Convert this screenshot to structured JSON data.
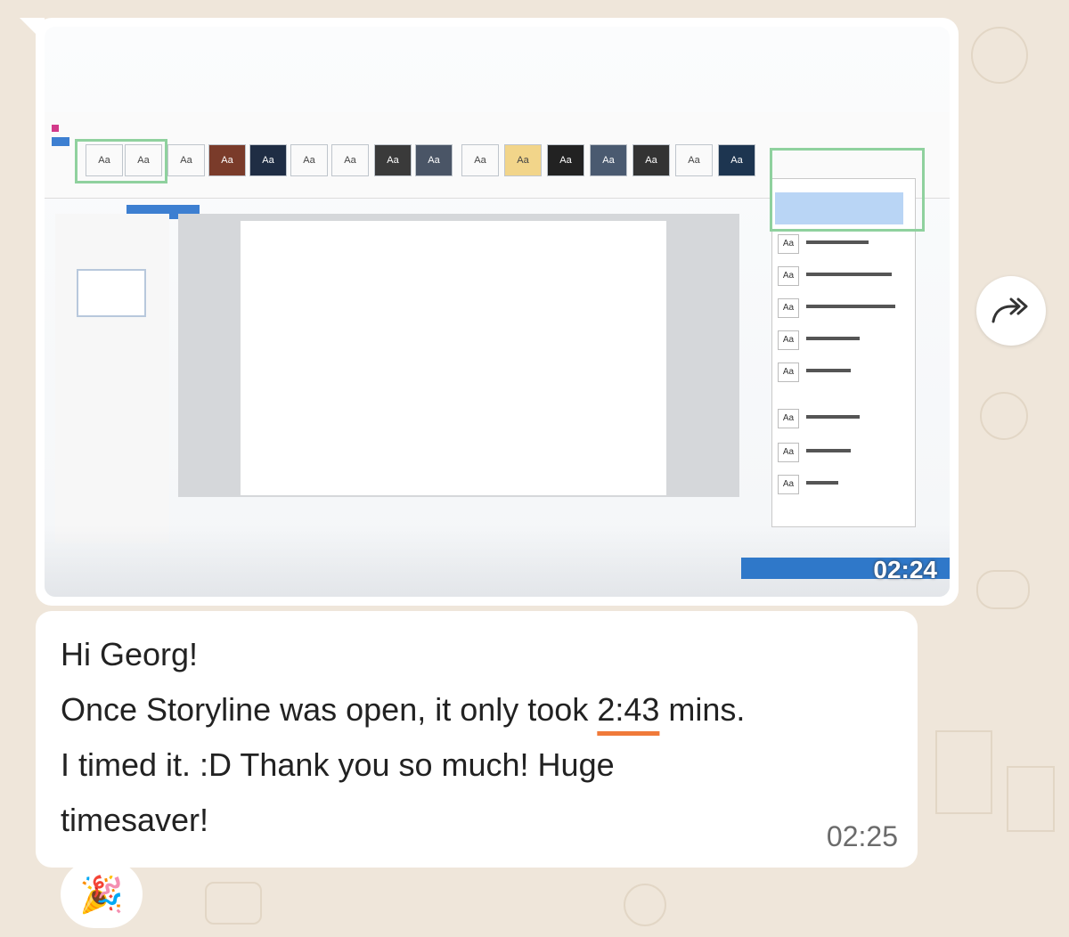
{
  "image_message": {
    "video_duration": "02:24"
  },
  "text_message": {
    "line1": "Hi Georg!",
    "line2_before": "Once Storyline was open, it only took ",
    "line2_highlight": "2:43",
    "line2_after": " mins.",
    "line3": "I timed it. :D Thank you so much! Huge",
    "line4": "timesaver!",
    "time": "02:25"
  },
  "reaction": {
    "emoji": "🎉"
  },
  "colors": {
    "background": "#efe6da",
    "bubble": "#ffffff",
    "highlight_underline": "#f07a3a",
    "green_highlight": "#8fd19e"
  },
  "icons": {
    "forward": "forward-icon",
    "reaction": "party-popper-icon"
  }
}
